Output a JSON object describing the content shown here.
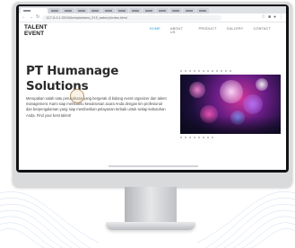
{
  "browser": {
    "url": "127.0.0.1:5500/templatemo_515_eatery/index.html",
    "tabs": [
      "",
      "",
      "",
      "",
      "",
      "",
      "",
      "",
      "",
      "",
      "",
      "",
      ""
    ]
  },
  "site": {
    "brand": "TALENT EVENT",
    "nav": [
      {
        "label": "HOME",
        "active": true
      },
      {
        "label": "ABOUT US",
        "active": false
      },
      {
        "label": "PRODUCT",
        "active": false
      },
      {
        "label": "GALLERY",
        "active": false
      },
      {
        "label": "CONTACT",
        "active": false
      }
    ]
  },
  "hero": {
    "heading_line1": "PT Humanage",
    "heading_line2": "Solutions",
    "paragraph": "Merupakan salah satu perusahaan yang bergerak di bidang event organizer dan talent management. Kami siap membantu kesuksesan acara Anda dengan tim profesional dan berpengalaman yang siap memberikan pelayanan terbaik untuk setiap kebutuhan Anda. Find your best talent!"
  },
  "colors": {
    "accent": "#1d9bd6",
    "heading": "#2a2a2a",
    "photo_magenta": "#d0379d",
    "photo_purple": "#6a1d86"
  },
  "icons": {
    "back": "arrow-left-icon",
    "forward": "arrow-right-icon",
    "reload": "reload-icon",
    "star": "star-icon",
    "menu": "kebab-icon"
  }
}
